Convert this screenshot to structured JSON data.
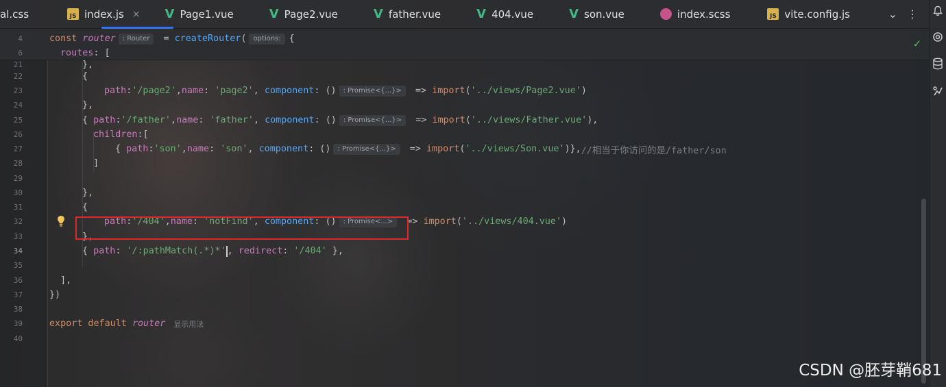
{
  "tabs": [
    {
      "label": "al.css",
      "icon": "css-file-icon"
    },
    {
      "label": "index.js",
      "icon": "js-file-icon",
      "active": true
    },
    {
      "label": "Page1.vue",
      "icon": "vue-file-icon"
    },
    {
      "label": "Page2.vue",
      "icon": "vue-file-icon"
    },
    {
      "label": "father.vue",
      "icon": "vue-file-icon"
    },
    {
      "label": "404.vue",
      "icon": "vue-file-icon"
    },
    {
      "label": "son.vue",
      "icon": "vue-file-icon"
    },
    {
      "label": "index.scss",
      "icon": "scss-file-icon"
    },
    {
      "label": "vite.config.js",
      "icon": "js-file-icon"
    }
  ],
  "icons": {
    "js_badge": "JS",
    "tab_close": "×",
    "tabs_dropdown": "⌄",
    "more": "⋮",
    "check": "✓"
  },
  "sticky": {
    "l1_num": "4",
    "l1_const": "const",
    "l1_var": "router",
    "l1_hint": ": Router",
    "l1_eq": " = ",
    "l1_fn": "createRouter",
    "l1_paren": "(",
    "l1_hint2": "options:",
    "l1_brace": "{",
    "l2_num": "6",
    "l2_prop": "routes",
    "l2_rest": ": ["
  },
  "code": {
    "n21": "21",
    "t21": "},",
    "n22": "22",
    "t22": "{",
    "n23": "23",
    "t23_k1": "path",
    "t23_v1": "'/page2'",
    "t23_k2": "name",
    "t23_v2": "'page2'",
    "t23_k3": "component",
    "t23_hint": ": Promise<{...}>",
    "t23_fn": "import",
    "t23_v3": "'../views/Page2.vue'",
    "n24": "24",
    "t24": "},",
    "n25": "25",
    "t25_k1": "path",
    "t25_v1": "'/father'",
    "t25_k2": "name",
    "t25_v2": "'father'",
    "t25_k3": "component",
    "t25_hint": ": Promise<{...}>",
    "t25_fn": "import",
    "t25_v3": "'../views/Father.vue'",
    "n26": "26",
    "t26_k": "children",
    "t26_r": ":[",
    "n27": "27",
    "t27_k1": "path",
    "t27_v1": "'son'",
    "t27_k2": "name",
    "t27_v2": "'son'",
    "t27_k3": "component",
    "t27_hint": ": Promise<{...}>",
    "t27_fn": "import",
    "t27_v3": "'../views/Son.vue'",
    "t27_cmt": "//相当于你访问的是/father/son",
    "n28": "28",
    "t28": "]",
    "n29": "29",
    "n30": "30",
    "t30": "},",
    "n31": "31",
    "t31": "{",
    "n32": "32",
    "t32_k1": "path",
    "t32_v1": "'/404'",
    "t32_k2": "name",
    "t32_v2": "'notFind'",
    "t32_k3": "component",
    "t32_hint": ": Promise<...>",
    "t32_fn": "import",
    "t32_v3": "'../views/404.vue'",
    "n33": "33",
    "t33": "},",
    "n34": "34",
    "t34_k1": "path",
    "t34_v1a": "'/:pathMatch(.*)*'",
    "t34_k2": "redirect",
    "t34_v2": "'/404'",
    "n35": "35",
    "n36": "36",
    "t36": "],",
    "n37": "37",
    "t37": "})",
    "n38": "38",
    "n39": "39",
    "t39_kw": "export default",
    "t39_var": "router",
    "t39_usage": "显示用法",
    "n40": "40"
  },
  "watermark": "CSDN @胚芽鞘681",
  "colors": {
    "accent": "#3574f0",
    "highlight": "#e0262b",
    "string": "#6aab73",
    "keyword": "#cf8e6d",
    "property": "#c77dbb",
    "function": "#56a8f5"
  }
}
